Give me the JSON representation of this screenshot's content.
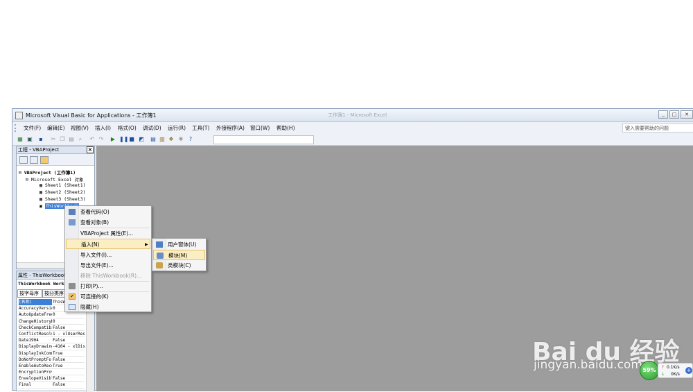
{
  "window": {
    "title": "Microsoft Visual Basic for Applications - 工作簿1",
    "ghost_title": "工作簿1 - Microsoft Excel",
    "buttons": [
      "_",
      "□",
      "✕"
    ]
  },
  "menubar": {
    "items": [
      "文件(F)",
      "编辑(E)",
      "视图(V)",
      "插入(I)",
      "格式(O)",
      "调试(D)",
      "运行(R)",
      "工具(T)",
      "外接程序(A)",
      "窗口(W)",
      "帮助(H)"
    ],
    "help_placeholder": "键入需要帮助的问题"
  },
  "project": {
    "title": "工程 - VBAProject",
    "tree": [
      "VBAProject (工作簿1)",
      "Microsoft Excel 对象",
      "Sheet1 (Sheet1)",
      "Sheet2 (Sheet2)",
      "Sheet3 (Sheet3)",
      "ThisWorkbook"
    ]
  },
  "properties": {
    "title": "属性 - ThisWorkbook",
    "combo": "ThisWorkbook Workbook",
    "tabs": [
      "按字母序",
      "按分类序"
    ],
    "rows": [
      {
        "k": "(名称)",
        "v": "ThisWorkbook"
      },
      {
        "k": "AccuracyVersion",
        "v": "0"
      },
      {
        "k": "AutoUpdateFrequency",
        "v": "0"
      },
      {
        "k": "ChangeHistoryDuration",
        "v": "0"
      },
      {
        "k": "CheckCompatibility",
        "v": "False"
      },
      {
        "k": "ConflictResolution",
        "v": "1 - xlUserResolution"
      },
      {
        "k": "Date1904",
        "v": "False"
      },
      {
        "k": "DisplayDrawingObjects",
        "v": "-4104 - xlDisplayShapes"
      },
      {
        "k": "DisplayInkComments",
        "v": "True"
      },
      {
        "k": "DoNotPromptForConvert",
        "v": "False"
      },
      {
        "k": "EnableAutoRecover",
        "v": "True"
      },
      {
        "k": "EncryptionProvider",
        "v": ""
      },
      {
        "k": "EnvelopeVisible",
        "v": "False"
      },
      {
        "k": "Final",
        "v": "False"
      }
    ]
  },
  "context_menu": {
    "items": [
      {
        "label": "查看代码(O)",
        "icon": "code-icon"
      },
      {
        "label": "查看对象(B)",
        "icon": "object-icon"
      },
      {
        "label": "VBAProject 属性(E)...",
        "icon": ""
      },
      {
        "label": "插入(N)",
        "icon": "",
        "submenu_arrow": "▶"
      },
      {
        "label": "导入文件(I)...",
        "icon": ""
      },
      {
        "label": "导出文件(E)...",
        "icon": ""
      },
      {
        "label": "移除 ThisWorkbook(R)...",
        "icon": ""
      },
      {
        "label": "打印(P)...",
        "icon": "print-icon"
      },
      {
        "label": "可连接的(K)",
        "icon": "check-icon"
      },
      {
        "label": "隐藏(H)",
        "icon": "hide-icon"
      }
    ]
  },
  "submenu": {
    "items": [
      {
        "label": "用户窗体(U)",
        "icon": "userform-icon"
      },
      {
        "label": "模块(M)",
        "icon": "module-icon"
      },
      {
        "label": "类模块(C)",
        "icon": "class-module-icon"
      }
    ]
  },
  "watermark": {
    "logo": "Bai du 经验",
    "url": "jingyan.baidu.com"
  },
  "network": {
    "percent": "59%",
    "up": "0.1K/s",
    "down": "0K/s"
  },
  "colors": {
    "workspace": "#9d9d9d",
    "selection": "#3c7fd8",
    "menu_hover": "#fbeec3"
  }
}
